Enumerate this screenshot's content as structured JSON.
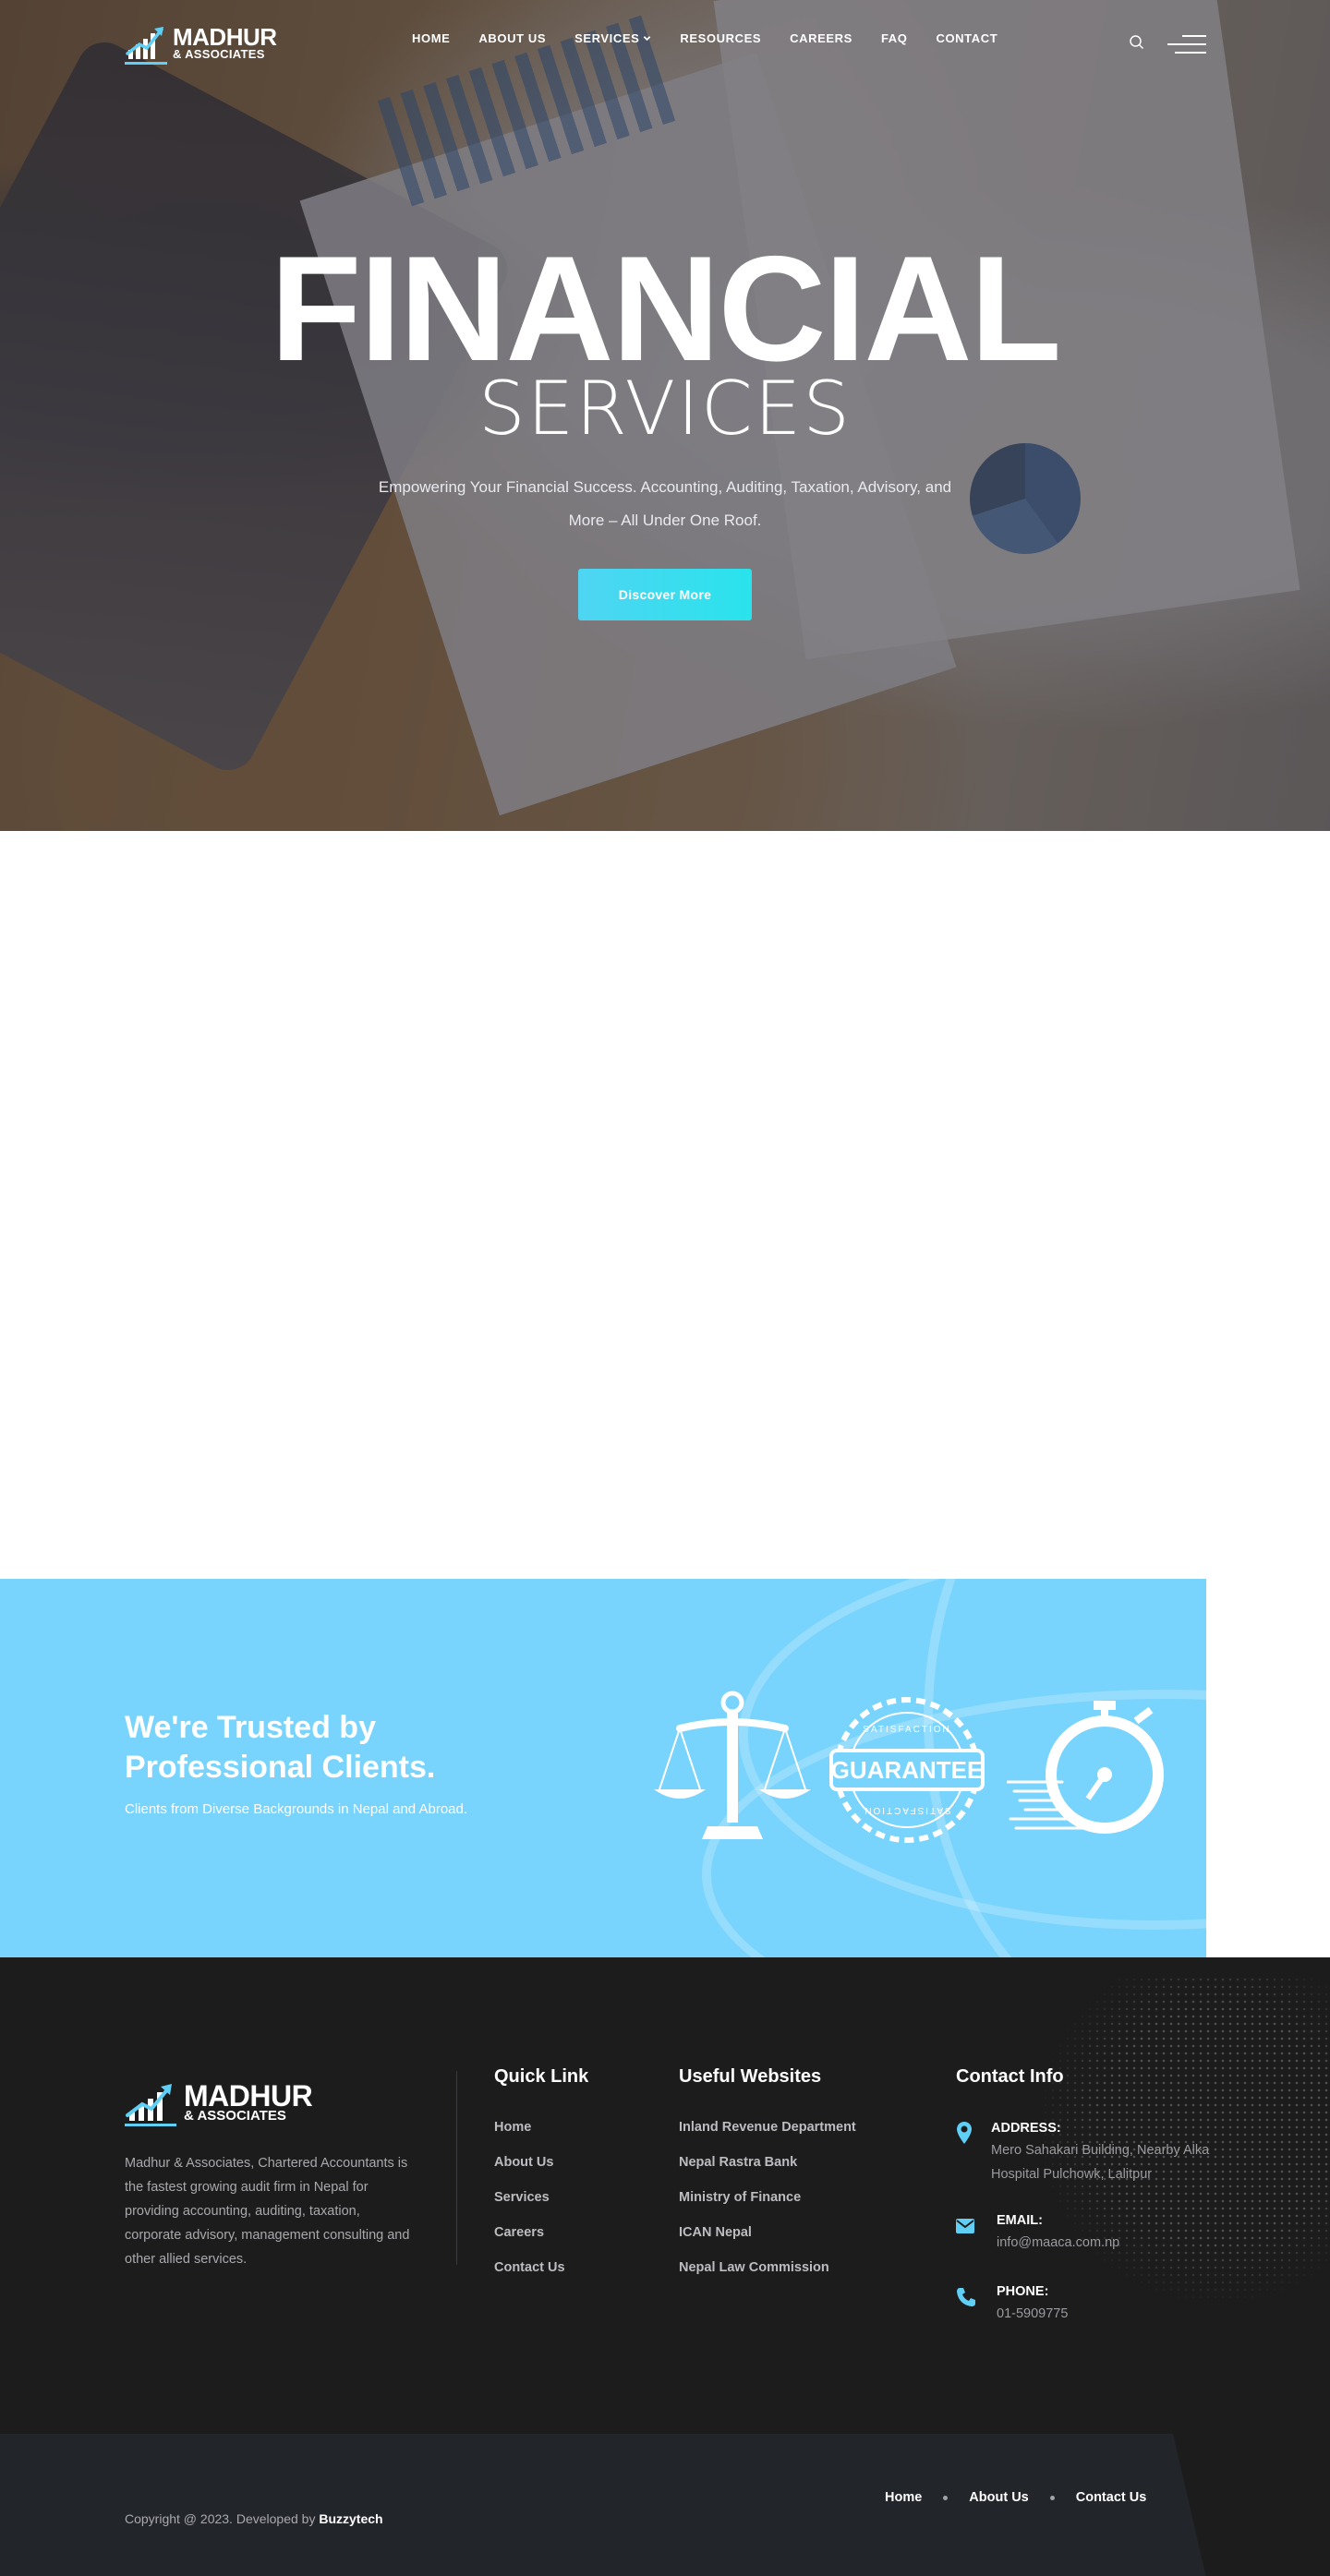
{
  "brand": {
    "name": "MADHUR",
    "sub": "& ASSOCIATES",
    "accent": "#5fcff5"
  },
  "nav": {
    "items": [
      {
        "label": "HOME"
      },
      {
        "label": "ABOUT US"
      },
      {
        "label": "SERVICES"
      },
      {
        "label": "RESOURCES"
      },
      {
        "label": "CAREERS"
      },
      {
        "label": "FAQ"
      },
      {
        "label": "CONTACT"
      }
    ],
    "icons": [
      "search-icon",
      "hamburger-menu-icon",
      "chevron-down-icon"
    ]
  },
  "hero": {
    "title": "FINANCIAL",
    "subtitle": "SERVICES",
    "description": "Empowering Your Financial Success. Accounting, Auditing, Taxation, Advisory, and More – All Under One Roof.",
    "button": "Discover More",
    "button_color": "#4fd5f2"
  },
  "trust": {
    "heading": "We're Trusted by Professional Clients.",
    "text": "Clients from Diverse Backgrounds in Nepal and Abroad.",
    "background": "#78d3fd",
    "badges": [
      {
        "icon": "balance-scale-icon"
      },
      {
        "icon": "guarantee-seal-icon",
        "label": "GUARANTEE",
        "ring_text": "SATISFACTION"
      },
      {
        "icon": "stopwatch-icon"
      }
    ]
  },
  "footer": {
    "description": "Madhur & Associates, Chartered Accountants is the fastest growing audit firm in Nepal for providing accounting, auditing, taxation, corporate advisory, management consulting and other allied services.",
    "quick_link": {
      "title": "Quick Link",
      "links": [
        "Home",
        "About Us",
        "Services",
        "Careers",
        "Contact Us"
      ]
    },
    "useful": {
      "title": "Useful Websites",
      "links": [
        "Inland Revenue Department",
        "Nepal Rastra Bank",
        "Ministry of Finance",
        "ICAN Nepal",
        "Nepal Law Commission"
      ]
    },
    "contact": {
      "title": "Contact Info",
      "address_label": "ADDRESS:",
      "address": "Mero Sahakari Building, Nearby Alka Hospital Pulchowk, Lalitpur",
      "email_label": "EMAIL:",
      "email": "info@maaca.com.np",
      "phone_label": "PHONE:",
      "phone": "01-5909775"
    }
  },
  "subfooter": {
    "copyright": "Copyright @ 2023. Developed by",
    "developer": "Buzzytech",
    "links": [
      "Home",
      "About Us",
      "Contact Us"
    ]
  }
}
